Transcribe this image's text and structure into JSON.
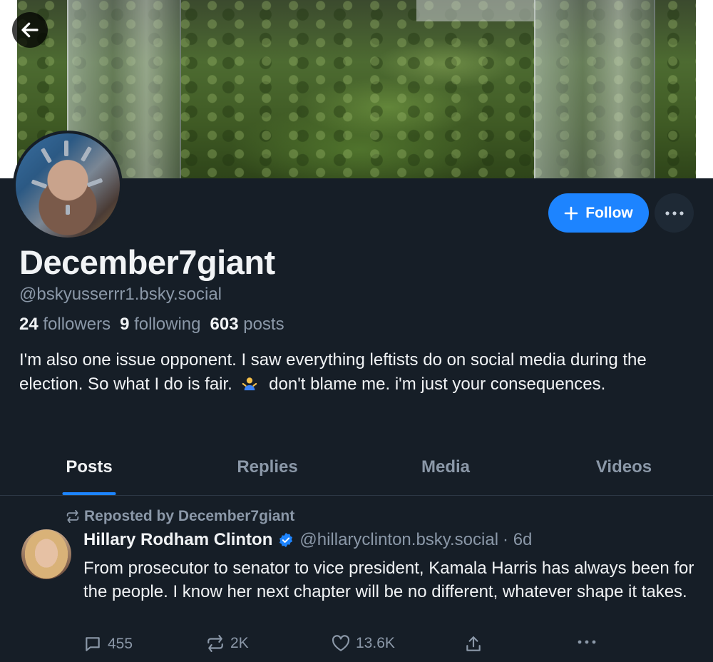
{
  "profile": {
    "display_name": "December7giant",
    "handle": "@bskyusserrr1.bsky.social",
    "followers_count": "24",
    "followers_label": "followers",
    "following_count": "9",
    "following_label": "following",
    "posts_count": "603",
    "posts_label": "posts",
    "bio_part1": "I'm also one issue opponent. I saw everything leftists do on social media during the election. So what I do is fair.",
    "bio_part2": "don't blame me. i'm just your consequences.",
    "follow_label": "Follow"
  },
  "tabs": [
    {
      "label": "Posts",
      "active": true
    },
    {
      "label": "Replies",
      "active": false
    },
    {
      "label": "Media",
      "active": false
    },
    {
      "label": "Videos",
      "active": false
    }
  ],
  "post": {
    "repost_label": "Reposted by December7giant",
    "author_name": "Hillary Rodham Clinton",
    "author_handle": "@hillaryclinton.bsky.social",
    "time": "· 6d",
    "text": "From prosecutor to senator to vice president, Kamala Harris has always been for the people. I know her next chapter will be no different, whatever shape it takes.",
    "replies": "455",
    "reposts": "2K",
    "likes": "13.6K"
  },
  "icons": {
    "back": "arrow-left-icon",
    "follow_plus": "plus-icon",
    "more": "ellipsis-icon",
    "reply": "speech-bubble-icon",
    "repost": "repost-arrows-icon",
    "like": "heart-icon",
    "share": "share-upload-icon",
    "verified": "verified-check-icon",
    "bio_emoji": "person-shrugging-emoji"
  },
  "colors": {
    "background": "#161e27",
    "accent": "#1d84ff",
    "muted_text": "#8b98a8",
    "primary_text": "#f1f3f5"
  }
}
